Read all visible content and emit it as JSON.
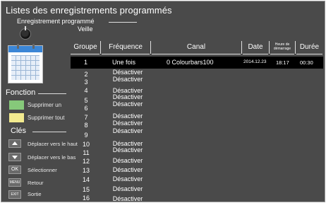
{
  "header": {
    "title": "Listes des enregistrements programmés",
    "recording_label": "Enregistrement programmé",
    "standby_label": "Veille"
  },
  "function_section": {
    "label": "Fonction",
    "items": [
      {
        "label": "Supprimer un",
        "color": "#86c97a"
      },
      {
        "label": "Supprimer tout",
        "color": "#f2ea8f"
      }
    ]
  },
  "keys_section": {
    "label": "Clés",
    "items": [
      {
        "key": "",
        "icon": "arrow-up-icon",
        "label": "Déplacer vers le haut"
      },
      {
        "key": "",
        "icon": "arrow-down-icon",
        "label": "Déplacer vers le bas"
      },
      {
        "key": "OK",
        "icon": "ok-key-icon",
        "label": "Sélectionner"
      },
      {
        "key": "MENU",
        "icon": "menu-key-icon",
        "label": "Retour"
      },
      {
        "key": "EXIT",
        "icon": "exit-key-icon",
        "label": "Sortie"
      }
    ]
  },
  "table": {
    "columns": [
      "Groupe",
      "Fréquence",
      "Canal",
      "Date",
      "Heure de démarrage",
      "Durée"
    ],
    "selected_row": {
      "group": "1",
      "frequency": "Une fois",
      "channel": "0 Colourbars100",
      "date": "2014.12.23",
      "start_time": "18:17",
      "duration": "00:30"
    },
    "rows": [
      {
        "group": "2",
        "frequency": "Désactiver"
      },
      {
        "group": "3",
        "frequency": "Désactiver"
      },
      {
        "group": "4",
        "frequency": "Désactiver"
      },
      {
        "group": "5",
        "frequency": "Désactiver"
      },
      {
        "group": "6",
        "frequency": "Désactiver"
      },
      {
        "group": "7",
        "frequency": "Désactiver"
      },
      {
        "group": "8",
        "frequency": "Désactiver"
      },
      {
        "group": "9",
        "frequency": "Désactiver"
      },
      {
        "group": "10",
        "frequency": "Désactiver"
      },
      {
        "group": "11",
        "frequency": "Désactiver"
      },
      {
        "group": "12",
        "frequency": "Désactiver"
      },
      {
        "group": "13",
        "frequency": "Désactiver"
      },
      {
        "group": "14",
        "frequency": "Désactiver"
      },
      {
        "group": "15",
        "frequency": "Désactiver"
      },
      {
        "group": "16",
        "frequency": "Désactiver"
      }
    ]
  }
}
